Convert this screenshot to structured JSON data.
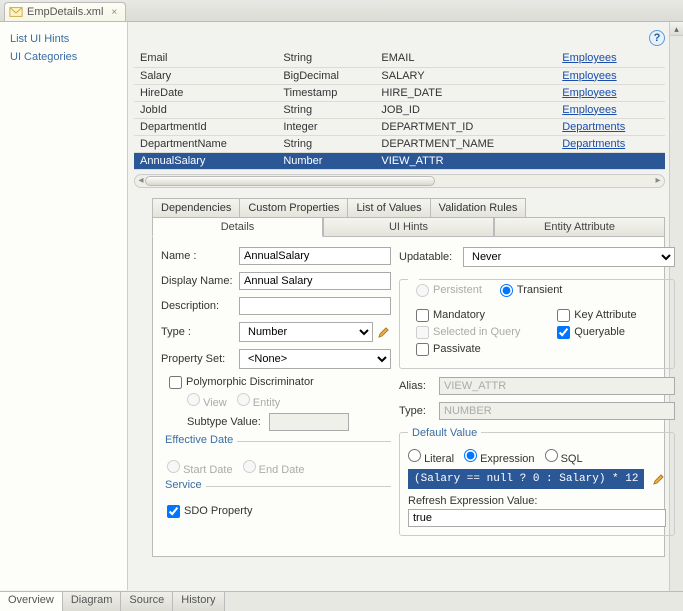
{
  "file_tab": {
    "label": "EmpDetails.xml"
  },
  "sidebar": {
    "items": [
      "List UI Hints",
      "UI Categories"
    ]
  },
  "attrs": {
    "rows": [
      {
        "name": "Email",
        "type": "String",
        "col": "EMAIL",
        "ent": "Employees"
      },
      {
        "name": "Salary",
        "type": "BigDecimal",
        "col": "SALARY",
        "ent": "Employees"
      },
      {
        "name": "HireDate",
        "type": "Timestamp",
        "col": "HIRE_DATE",
        "ent": "Employees"
      },
      {
        "name": "JobId",
        "type": "String",
        "col": "JOB_ID",
        "ent": "Employees"
      },
      {
        "name": "DepartmentId",
        "type": "Integer",
        "col": "DEPARTMENT_ID",
        "ent": "Departments"
      },
      {
        "name": "DepartmentName",
        "type": "String",
        "col": "DEPARTMENT_NAME",
        "ent": "Departments"
      },
      {
        "name": "AnnualSalary",
        "type": "Number",
        "col": "VIEW_ATTR",
        "ent": ""
      }
    ],
    "selected": 6
  },
  "subtabs1": [
    "Dependencies",
    "Custom Properties",
    "List of Values",
    "Validation Rules"
  ],
  "subtabs2": [
    "Details",
    "UI Hints",
    "Entity Attribute"
  ],
  "subtabs2_active": 0,
  "details": {
    "name_label": "Name :",
    "name_value": "AnnualSalary",
    "display_name_label": "Display Name:",
    "display_name_value": "Annual Salary",
    "description_label": "Description:",
    "description_value": "",
    "type_label": "Type :",
    "type_value": "Number",
    "propset_label": "Property Set:",
    "propset_value": "<None>",
    "polymorph_label": "Polymorphic Discriminator",
    "view_label": "View",
    "entity_label": "Entity",
    "subtype_label": "Subtype Value:",
    "effective_date_legend": "Effective Date",
    "start_date_label": "Start Date",
    "end_date_label": "End Date",
    "service_legend": "Service",
    "sdo_label": "SDO Property",
    "updatable_label": "Updatable:",
    "updatable_value": "Never",
    "persistent_label": "Persistent",
    "transient_label": "Transient",
    "mandatory_label": "Mandatory",
    "keyattr_label": "Key Attribute",
    "selinquery_label": "Selected in Query",
    "queryable_label": "Queryable",
    "passivate_label": "Passivate",
    "alias_label": "Alias:",
    "alias_value": "VIEW_ATTR",
    "rtype_label": "Type:",
    "rtype_value": "NUMBER",
    "default_legend": "Default Value",
    "literal_label": "Literal",
    "expression_label": "Expression",
    "sql_label": "SQL",
    "expr_value": "(Salary == null ? 0 : Salary) * 12",
    "refresh_label": "Refresh Expression Value:",
    "refresh_value": "true"
  },
  "bottom_tabs": [
    "Overview",
    "Diagram",
    "Source",
    "History"
  ],
  "bottom_active": 0
}
